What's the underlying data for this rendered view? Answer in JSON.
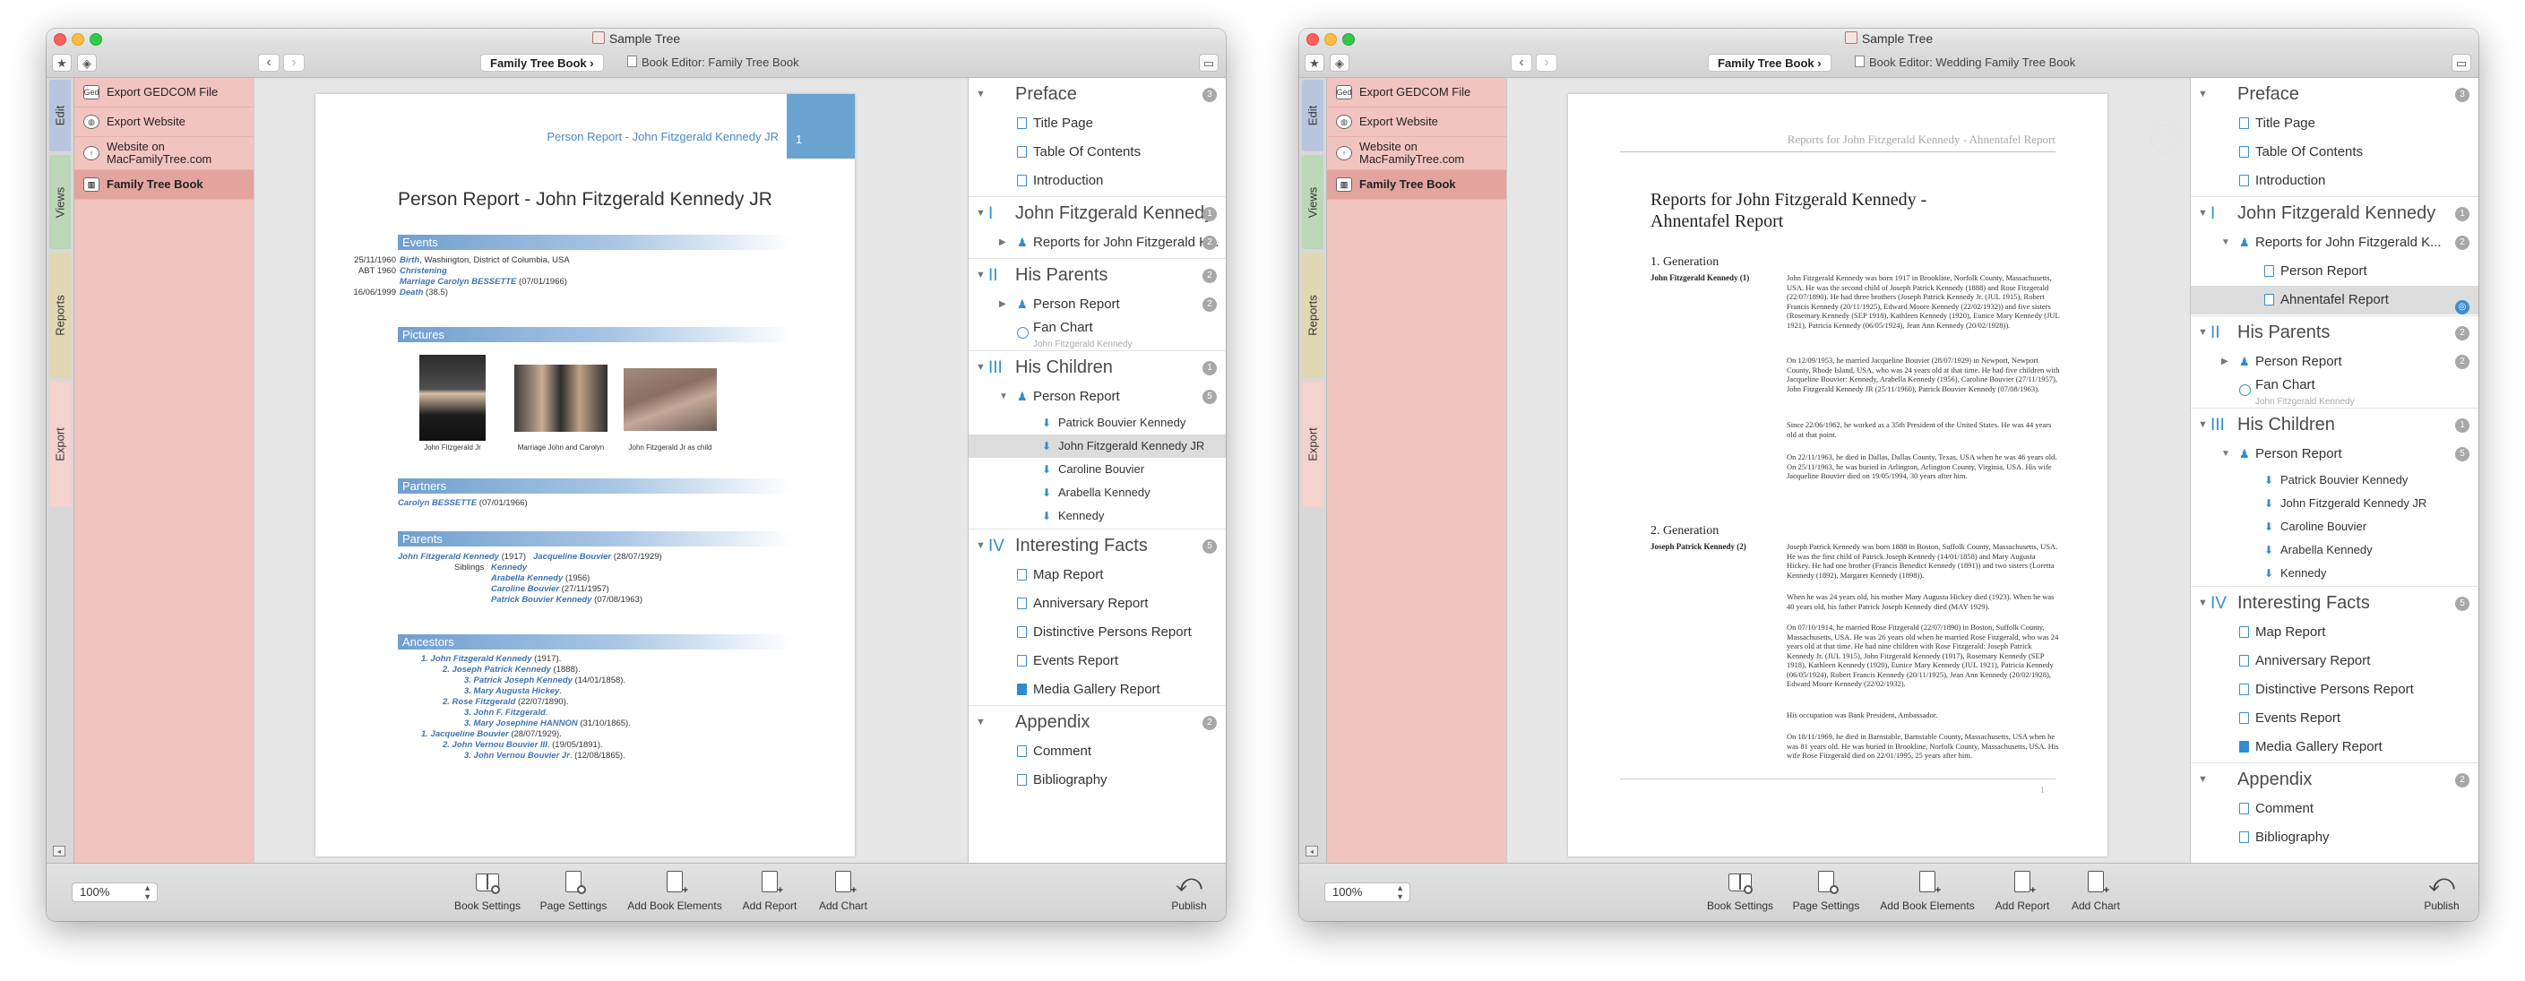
{
  "windows": [
    {
      "title": "Sample Tree",
      "breadcrumb_1": "Family Tree Book",
      "breadcrumb_2": "Book Editor: Family Tree Book",
      "tabs": [
        "Edit",
        "Views",
        "Reports",
        "Export"
      ],
      "sidebar": [
        {
          "label": "Export GEDCOM File",
          "icon": "gedcom-icon"
        },
        {
          "label": "Export Website",
          "icon": "globe-icon"
        },
        {
          "label": "Website on MacFamilyTree.com",
          "icon": "upload-icon"
        },
        {
          "label": "Family Tree Book",
          "icon": "book-icon"
        }
      ],
      "zoom": "100%"
    },
    {
      "title": "Sample Tree",
      "breadcrumb_1": "Family Tree Book",
      "breadcrumb_2": "Book Editor: Wedding Family Tree Book",
      "tabs": [
        "Edit",
        "Views",
        "Reports",
        "Export"
      ],
      "sidebar": [
        {
          "label": "Export GEDCOM File",
          "icon": "gedcom-icon"
        },
        {
          "label": "Export Website",
          "icon": "globe-icon"
        },
        {
          "label": "Website on MacFamilyTree.com",
          "icon": "upload-icon"
        },
        {
          "label": "Family Tree Book",
          "icon": "book-icon"
        }
      ],
      "zoom": "100%"
    }
  ],
  "page_a": {
    "running_head": "Person Report - John Fitzgerald Kennedy JR",
    "page_number": "1",
    "title": "Person Report - John Fitzgerald Kennedy JR",
    "sections": {
      "events": "Events",
      "pictures": "Pictures",
      "partners": "Partners",
      "parents": "Parents",
      "ancestors": "Ancestors"
    },
    "events": [
      {
        "date": "25/11/1960",
        "label": "Birth",
        "rest": ", Washington, District of Columbia, USA"
      },
      {
        "date": "ABT 1960",
        "label": "Christening",
        "rest": ""
      },
      {
        "date": "",
        "label": "Marriage Carolyn BESSETTE",
        "rest": " (07/01/1966)"
      },
      {
        "date": "16/06/1999",
        "label": "Death",
        "rest": " (38.5)"
      }
    ],
    "pictures": [
      {
        "caption": "John Fitzgerald Jr"
      },
      {
        "caption": "Marriage John and Carolyn"
      },
      {
        "caption": "John Fitzgerald Jr as child"
      }
    ],
    "partners": [
      {
        "name": "Carolyn BESSETTE",
        "rest": " (07/01/1966)"
      }
    ],
    "parents": {
      "father": "John Fitzgerald Kennedy",
      "father_rest": " (1917)",
      "mother": "Jacqueline Bouvier",
      "mother_rest": " (28/07/1929)",
      "siblings_label": "Siblings",
      "siblings": [
        {
          "name": "Kennedy",
          "rest": ""
        },
        {
          "name": "Arabella Kennedy",
          "rest": " (1956)"
        },
        {
          "name": "Caroline Bouvier",
          "rest": " (27/11/1957)"
        },
        {
          "name": "Patrick Bouvier Kennedy",
          "rest": " (07/08/1963)"
        }
      ]
    },
    "ancestors": [
      {
        "indent": 0,
        "name": "1. John Fitzgerald Kennedy",
        "rest": " (1917)."
      },
      {
        "indent": 1,
        "name": "2. Joseph Patrick Kennedy",
        "rest": " (1888)."
      },
      {
        "indent": 2,
        "name": "3. Patrick Joseph Kennedy",
        "rest": " (14/01/1858)."
      },
      {
        "indent": 2,
        "name": "3. Mary Augusta Hickey",
        "rest": "."
      },
      {
        "indent": 1,
        "name": "2. Rose Fitzgerald",
        "rest": " (22/07/1890)."
      },
      {
        "indent": 2,
        "name": "3. John F. Fitzgerald",
        "rest": "."
      },
      {
        "indent": 2,
        "name": "3. Mary Josephine HANNON",
        "rest": " (31/10/1865)."
      },
      {
        "indent": 0,
        "name": "1. Jacqueline Bouvier",
        "rest": " (28/07/1929)."
      },
      {
        "indent": 1,
        "name": "2. John Vernou Bouvier III",
        "rest": ". (19/05/1891)."
      },
      {
        "indent": 2,
        "name": "3. John Vernou Bouvier Jr",
        "rest": ". (12/08/1865)."
      }
    ]
  },
  "page_b": {
    "running_head": "Reports for John Fitzgerald Kennedy - Ahnentafel Report",
    "title": "Reports for John Fitzgerald Kennedy - Ahnentafel Report",
    "gen1": "1. Generation",
    "gen1_person": "John Fitzgerald Kennedy (1)",
    "gen1_paras": [
      "John Fitzgerald Kennedy was born 1917 in Brookline, Norfolk County, Massachusetts, USA. He was the second child of Joseph Patrick Kennedy (1888) and Rose Fitzgerald (22/07/1890). He had three brothers (Joseph Patrick Kennedy Jr. (JUL 1915), Robert Francis Kennedy (20/11/1925), Edward Moore Kennedy (22/02/1932)) and five sisters (Rosemary Kennedy (SEP 1918), Kathleen Kennedy (1920), Eunice Mary Kennedy (JUL 1921), Patricia Kennedy (06/05/1924), Jean Ann Kennedy (20/02/1928)).",
      "On 12/09/1953, he married Jacqueline Bouvier (28/07/1929) in Newport, Newport County, Rhode Island, USA, who was 24 years old at that time. He had five children with Jacqueline Bouvier: Kennedy, Arabella Kennedy (1956), Caroline Bouvier (27/11/1957), John Fitzgerald Kennedy JR (25/11/1960), Patrick Bouvier Kennedy (07/08/1963).",
      "Since 22/06/1962, he worked as a 35th President of the United States. He was 44 years old at that point.",
      "On 22/11/1963, he died in Dallas, Dallas County, Texas, USA when he was 46 years old. On 25/11/1963, he was buried in Arlington, Arlington County, Virginia, USA. His wife Jacqueline Bouvier died on 19/05/1994, 30 years after him."
    ],
    "gen2": "2. Generation",
    "gen2_person": "Joseph Patrick Kennedy (2)",
    "gen2_paras": [
      "Joseph Patrick Kennedy was born 1888 in Boston, Suffolk County, Massachusetts, USA. He was the first child of Patrick Joseph Kennedy (14/01/1858) and Mary Augusta Hickey. He had one brother (Francis Benedict Kennedy (1891)) and two sisters (Loretta Kennedy (1892), Margaret Kennedy (1898)).",
      "When he was 24 years old, his mother Mary Augusta Hickey died (1923). When he was 40 years old, his father Patrick Joseph Kennedy died (MAY 1929).",
      "On 07/10/1914, he married Rose Fitzgerald (22/07/1890) in Boston, Suffolk County, Massachusetts, USA. He was 26 years old when he married Rose Fitzgerald, who was 24 years old at that time. He had nine children with Rose Fitzgerald: Joseph Patrick Kennedy Jr. (JUL 1915), John Fitzgerald Kennedy (1917), Rosemary Kennedy (SEP 1918), Kathleen Kennedy (1920), Eunice Mary Kennedy (JUL 1921), Patricia Kennedy (06/05/1924), Robert Francis Kennedy (20/11/1925), Jean Ann Kennedy (20/02/1928), Edward Moore Kennedy (22/02/1932).",
      "His occupation was Bank President, Ambassador.",
      "On 18/11/1969, he died in Barnstable, Barnstable County, Massachusetts, USA when he was 81 years old. He was buried in Brookline, Norfolk County, Massachusetts, USA. His wife Rose Fitzgerald died on 22/01/1995, 25 years after him."
    ],
    "page_number": "1"
  },
  "outline_a": {
    "preface": {
      "label": "Preface",
      "count": "3",
      "items": [
        "Title Page",
        "Table Of Contents",
        "Introduction"
      ]
    },
    "part1": {
      "roman": "I",
      "label": "John Fitzgerald Kennedy",
      "count": "1",
      "items": [
        {
          "label": "Reports for John Fitzgerald K...",
          "count": "2"
        }
      ]
    },
    "part2": {
      "roman": "II",
      "label": "His Parents",
      "count": "2",
      "items": [
        {
          "label": "Person Report",
          "count": "2"
        }
      ],
      "fan": {
        "label": "Fan Chart",
        "sub": "John Fitzgerald Kennedy"
      }
    },
    "part3": {
      "roman": "III",
      "label": "His Children",
      "count": "1",
      "report": {
        "label": "Person Report",
        "count": "5"
      },
      "children": [
        "Patrick Bouvier Kennedy",
        "John Fitzgerald Kennedy JR",
        "Caroline Bouvier",
        "Arabella Kennedy",
        "Kennedy"
      ]
    },
    "part4": {
      "roman": "IV",
      "label": "Interesting Facts",
      "count": "5",
      "items": [
        "Map Report",
        "Anniversary Report",
        "Distinctive Persons Report",
        "Events Report",
        "Media Gallery Report"
      ]
    },
    "appendix": {
      "label": "Appendix",
      "count": "2",
      "items": [
        "Comment",
        "Bibliography"
      ]
    }
  },
  "outline_b": {
    "preface": {
      "label": "Preface",
      "count": "3",
      "items": [
        "Title Page",
        "Table Of Contents",
        "Introduction"
      ]
    },
    "part1": {
      "roman": "I",
      "label": "John Fitzgerald Kennedy",
      "count": "1",
      "report": {
        "label": "Reports for John Fitzgerald K...",
        "count": "2"
      },
      "children": [
        "Person Report",
        "Ahnentafel Report"
      ]
    },
    "part2": {
      "roman": "II",
      "label": "His Parents",
      "count": "2",
      "items": [
        {
          "label": "Person Report",
          "count": "2"
        }
      ],
      "fan": {
        "label": "Fan Chart",
        "sub": "John Fitzgerald Kennedy"
      }
    },
    "part3": {
      "roman": "III",
      "label": "His Children",
      "count": "1",
      "report": {
        "label": "Person Report",
        "count": "5"
      },
      "children": [
        "Patrick Bouvier Kennedy",
        "John Fitzgerald Kennedy JR",
        "Caroline Bouvier",
        "Arabella Kennedy",
        "Kennedy"
      ]
    },
    "part4": {
      "roman": "IV",
      "label": "Interesting Facts",
      "count": "5",
      "items": [
        "Map Report",
        "Anniversary Report",
        "Distinctive Persons Report",
        "Events Report",
        "Media Gallery Report"
      ]
    },
    "appendix": {
      "label": "Appendix",
      "count": "2",
      "items": [
        "Comment",
        "Bibliography"
      ]
    }
  },
  "bottom_tools": [
    "Book Settings",
    "Page Settings",
    "Add Book Elements",
    "Add Report",
    "Add Chart"
  ],
  "publish_label": "Publish",
  "colors": {
    "accent": "#3a8fd0",
    "sidebar": "#f2c4c0",
    "sidebar_selected": "#e3a49e",
    "section_bar": "#6f9fcf"
  }
}
